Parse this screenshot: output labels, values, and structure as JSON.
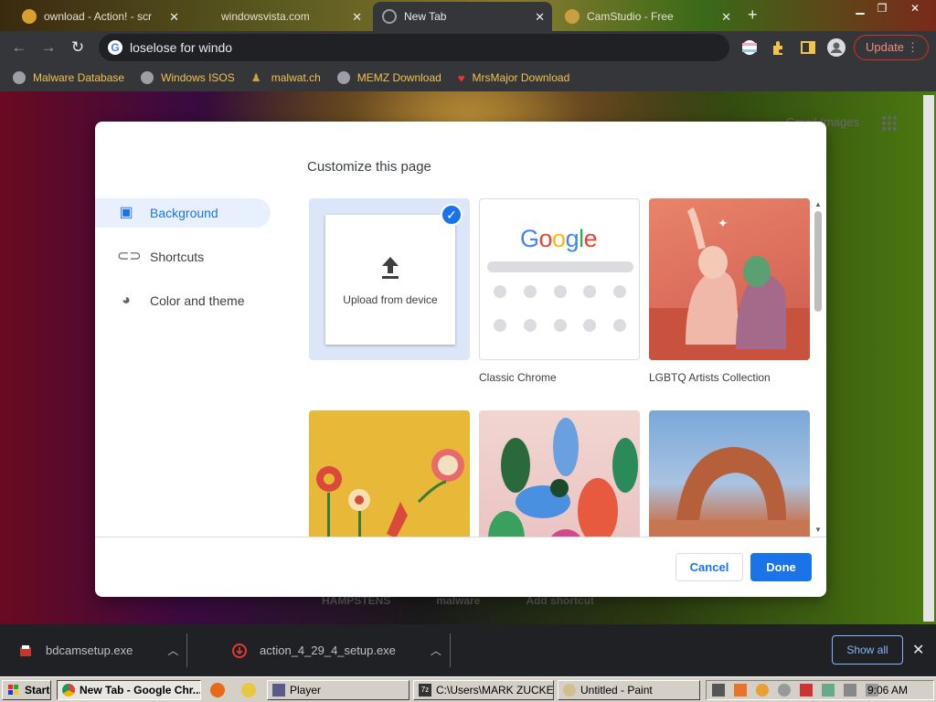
{
  "tabs": [
    {
      "title": "ownload - Action! - scr",
      "active": false
    },
    {
      "title": "windowsvista.com",
      "active": false
    },
    {
      "title": "New Tab",
      "active": true
    },
    {
      "title": "CamStudio - Free",
      "active": false
    }
  ],
  "omnibox": {
    "text": "loselose for windo"
  },
  "toolbar": {
    "update_label": "Update"
  },
  "bookmarks": [
    {
      "label": "Malware Database",
      "icon": "globe-icon"
    },
    {
      "label": "Windows ISOS",
      "icon": "globe-icon"
    },
    {
      "label": "malwat.ch",
      "icon": "pin-icon"
    },
    {
      "label": "MEMZ Download",
      "icon": "globe-icon"
    },
    {
      "label": "MrsMajor Download",
      "icon": "heart-icon"
    }
  ],
  "ntp": {
    "top_links": "Gmail  Images",
    "shortcuts": [
      "HAMPSTENS",
      "malware",
      "Add shortcut"
    ]
  },
  "dialog": {
    "title": "Customize this page",
    "nav": [
      {
        "label": "Background",
        "icon": "image-icon",
        "selected": true
      },
      {
        "label": "Shortcuts",
        "icon": "link-icon",
        "selected": false
      },
      {
        "label": "Color and theme",
        "icon": "palette-icon",
        "selected": false
      }
    ],
    "tiles": {
      "upload": "Upload from device",
      "classic": "Classic Chrome",
      "lgbtq": "LGBTQ Artists Collection"
    },
    "google_logo": "Google",
    "cancel_label": "Cancel",
    "done_label": "Done"
  },
  "downloads": {
    "items": [
      {
        "name": "bdcamsetup.exe"
      },
      {
        "name": "action_4_29_4_setup.exe"
      }
    ],
    "show_all_label": "Show all"
  },
  "taskbar": {
    "start_label": "Start",
    "buttons": [
      {
        "label": "New Tab - Google Chr...",
        "pressed": true
      },
      {
        "label": "Player",
        "pressed": false
      },
      {
        "label": "C:\\Users\\MARK ZUCKER...",
        "pressed": false
      },
      {
        "label": "Untitled - Paint",
        "pressed": false
      }
    ],
    "clock": "9:06 AM"
  },
  "colors": {
    "accent": "#1a73e8",
    "update_red": "#d93025",
    "bookmark_text": "#f2c14e"
  }
}
